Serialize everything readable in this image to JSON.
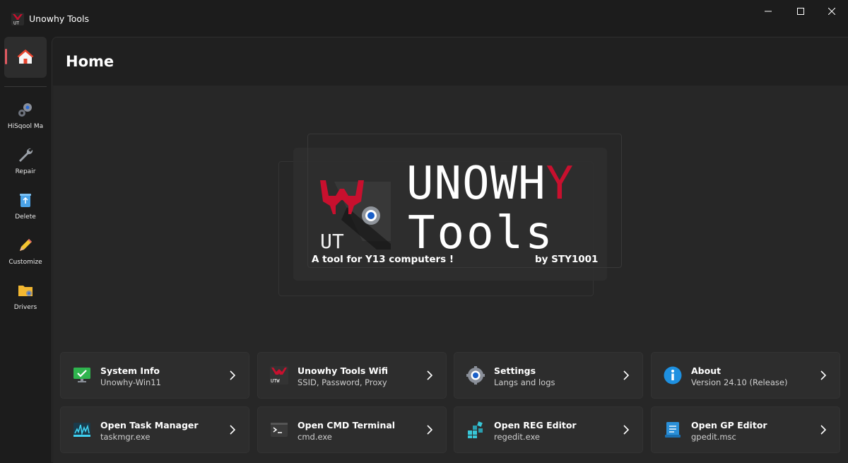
{
  "window": {
    "title": "Unowhy Tools"
  },
  "sidebar": {
    "items": [
      {
        "label": "HiSqool Ma"
      },
      {
        "label": "Repair"
      },
      {
        "label": "Delete"
      },
      {
        "label": "Customize"
      },
      {
        "label": "Drivers"
      }
    ]
  },
  "page": {
    "title": "Home"
  },
  "hero": {
    "logo_text": "UT",
    "title_line1_main": "UNOWH",
    "title_line1_accent": "Y",
    "title_line2": "Tools",
    "tagline": "A tool for Y13 computers !",
    "author": "by STY1001"
  },
  "cards": [
    {
      "title": "System Info",
      "subtitle": "Unowhy-Win11",
      "icon": "monitor-check-icon"
    },
    {
      "title": "Unowhy Tools Wifi",
      "subtitle": "SSID, Password, Proxy",
      "icon": "utw-logo-icon",
      "icon_text": "UTW"
    },
    {
      "title": "Settings",
      "subtitle": "Langs and logs",
      "icon": "gear-icon"
    },
    {
      "title": "About",
      "subtitle": "Version 24.10 (Release)",
      "icon": "info-icon"
    },
    {
      "title": "Open Task Manager",
      "subtitle": "taskmgr.exe",
      "icon": "task-manager-icon"
    },
    {
      "title": "Open CMD Terminal",
      "subtitle": "cmd.exe",
      "icon": "terminal-icon"
    },
    {
      "title": "Open REG Editor",
      "subtitle": "regedit.exe",
      "icon": "regedit-icon"
    },
    {
      "title": "Open GP Editor",
      "subtitle": "gpedit.msc",
      "icon": "gpedit-icon"
    }
  ],
  "colors": {
    "accent_red": "#c8102e",
    "nav_indicator": "#e05a61",
    "info_blue": "#1e90e0"
  }
}
